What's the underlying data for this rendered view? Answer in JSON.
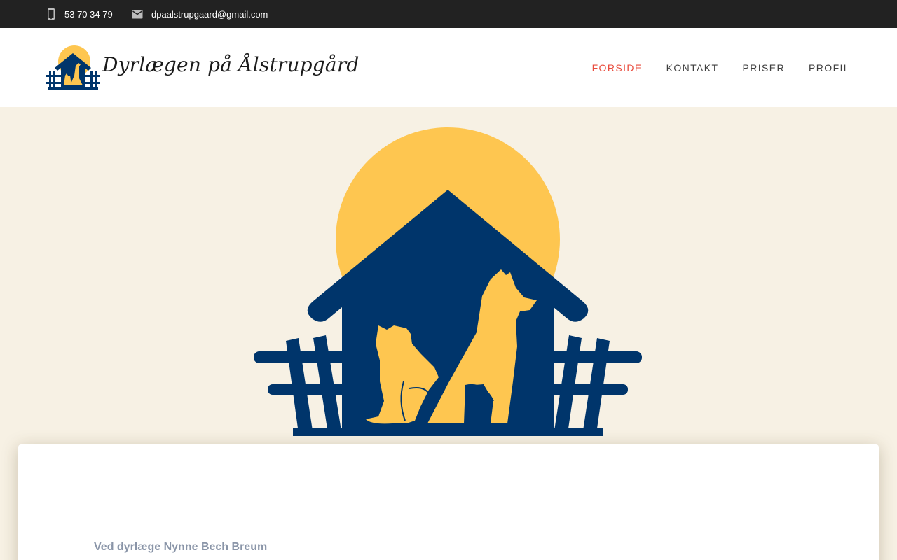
{
  "topbar": {
    "phone_icon": "phone-icon",
    "phone": "53 70 34 79",
    "email_icon": "mail-icon",
    "email": "dpaalstrupgaard@gmail.com"
  },
  "header": {
    "logo_text": "Dyrlægen på Ålstrupgård",
    "nav": [
      {
        "label": "FORSIDE",
        "active": true
      },
      {
        "label": "KONTAKT",
        "active": false
      },
      {
        "label": "PRISER",
        "active": false
      },
      {
        "label": "PROFIL",
        "active": false
      }
    ]
  },
  "hero": {
    "image": "house-with-cat-and-dog-logo",
    "colors": {
      "background": "#f7f1e4",
      "sun": "#fec650",
      "house": "#00356b"
    }
  },
  "content": {
    "subtitle": "Ved dyrlæge Nynne Bech Breum"
  },
  "colors": {
    "accent": "#e94b3c",
    "topbar": "#222222"
  }
}
